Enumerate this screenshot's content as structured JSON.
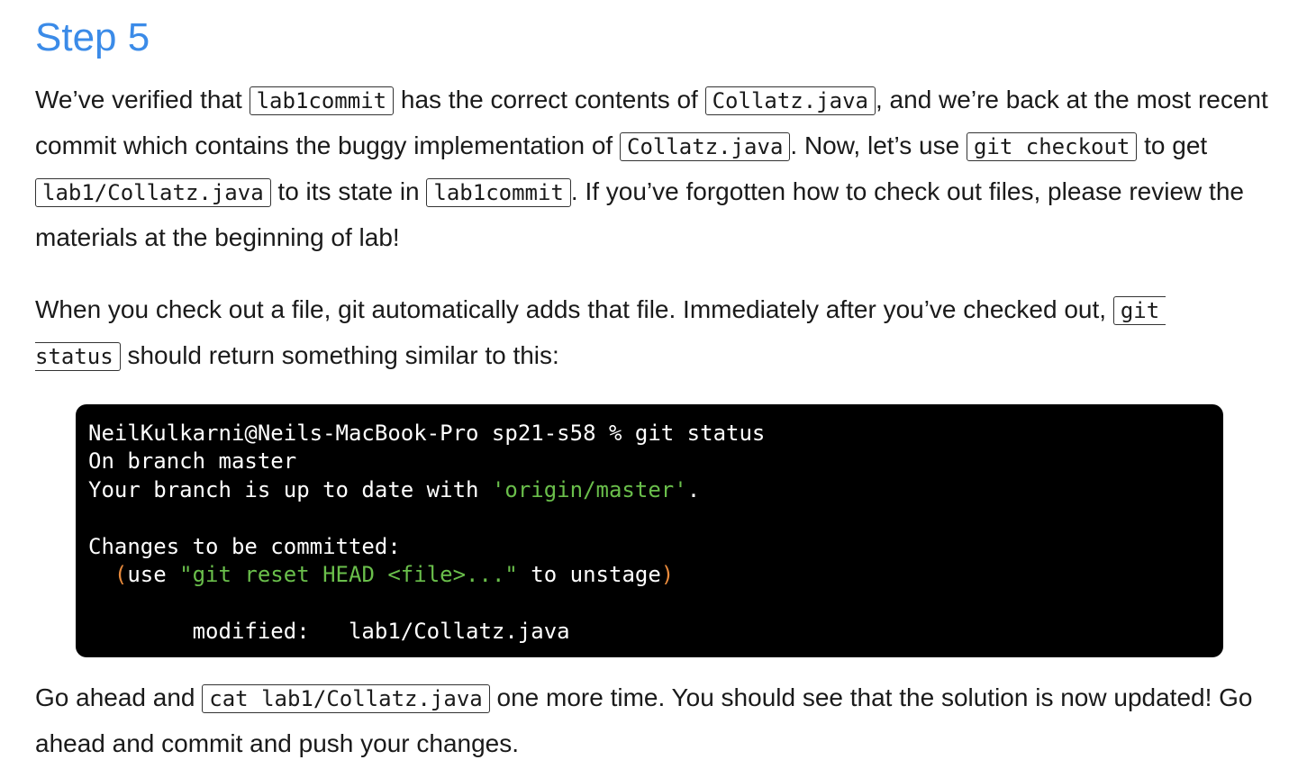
{
  "heading": "Step 5",
  "para1": {
    "t1": "We’ve verified that ",
    "c1": "lab1commit",
    "t2": " has the correct contents of ",
    "c2": "Collatz.java",
    "t3": ", and we’re back at the most recent commit which contains the buggy implementation of ",
    "c3": "Collatz.java",
    "t4": ". Now, let’s use ",
    "c4": "git checkout",
    "t5": " to get ",
    "c5": "lab1/Collatz.java",
    "t6": " to its state in ",
    "c6": "lab1commit",
    "t7": ". If you’ve forgotten how to check out files, please review the materials at the beginning of lab!"
  },
  "para2": {
    "t1": "When you check out a file, git automatically adds that file. Immediately after you’ve checked out, ",
    "c1a": "git",
    "c1b": "status",
    "t2": " should return something similar to this:"
  },
  "terminal": {
    "line1": "NeilKulkarni@Neils-MacBook-Pro sp21-s58 % git status",
    "line2": "On branch master",
    "line3_pre": "Your branch is up to date with ",
    "line3_str": "'origin/master'",
    "line3_post": ".",
    "line5": "Changes to be committed:",
    "line6_paren_open": "  (",
    "line6_use": "use ",
    "line6_str": "\"git reset HEAD <file>...\"",
    "line6_post": " to unstage",
    "line6_paren_close": ")",
    "line8": "        modified:   lab1/Collatz.java"
  },
  "para3": {
    "t1": "Go ahead and ",
    "c1": "cat lab1/Collatz.java",
    "t2": " one more time. You should see that the solution is now updated! Go ahead and commit and push your changes."
  }
}
